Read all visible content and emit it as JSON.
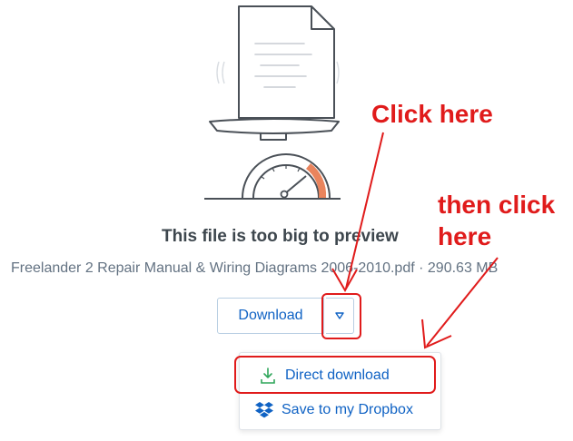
{
  "preview": {
    "title": "This file is too big to preview",
    "file_name": "Freelander 2 Repair Manual & Wiring Diagrams 2006-2010.pdf",
    "separator": "·",
    "file_size": "290.63 MB"
  },
  "actions": {
    "download_label": "Download",
    "arrow_icon": "triangle-down-icon"
  },
  "menu": {
    "items": [
      {
        "label": "Direct download",
        "icon": "download-icon"
      },
      {
        "label": "Save to my Dropbox",
        "icon": "dropbox-icon"
      }
    ]
  },
  "annotations": {
    "callout_1": "Click here",
    "callout_2_line1": "then click",
    "callout_2_line2": "here",
    "color": "#e01b1b"
  },
  "colors": {
    "link_blue": "#0f62c4",
    "meter_orange": "#e9845d",
    "illustration_stroke": "#4a5057"
  }
}
